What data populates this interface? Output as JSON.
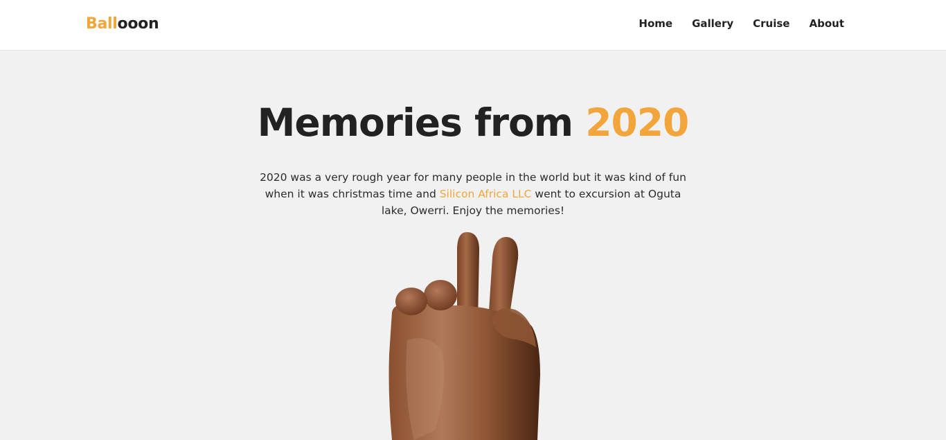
{
  "header": {
    "logo_part1": "Ball",
    "logo_part2": "ooon",
    "nav": [
      "Home",
      "Gallery",
      "Cruise",
      "About"
    ]
  },
  "hero": {
    "title_text": "Memories from ",
    "title_year": "2020",
    "desc_before": "2020 was a very rough year for many people in the world but it was kind of fun when it was christmas time and ",
    "desc_link": "Silicon Africa LLC",
    "desc_after": " went to excursion at Oguta lake, Owerri. Enjoy the memories!",
    "image_name": "peace-sign-hand-3d"
  },
  "colors": {
    "accent": "#f2a53a",
    "text": "#222222",
    "background": "#f1f1f1",
    "header_bg": "#ffffff"
  }
}
